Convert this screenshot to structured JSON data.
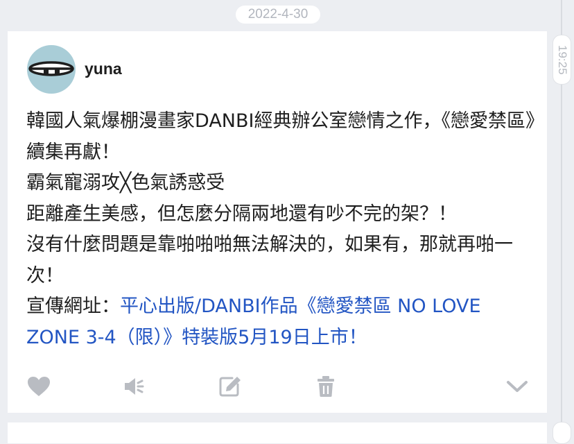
{
  "date_label": "2022-4-30",
  "time_label": "19:25",
  "post": {
    "author": "yuna",
    "lines": [
      "韓國人氣爆棚漫畫家DANBI經典辦公室戀情之作，《戀愛禁區》續集再獻！",
      "霸氣寵溺攻╳色氣誘惑受",
      "距離產生美感，但怎麼分隔兩地還有吵不完的架？！",
      "沒有什麼問題是靠啪啪啪無法解決的，如果有，那就再啪一次！"
    ],
    "link_prefix": "宣傳網址：",
    "link_text": "平心出版/DANBI作品《戀愛禁區 NO LOVE ZONE 3-4（限）》特裝版5月19日上市！"
  },
  "actions": [
    "heart-icon",
    "speaker-icon",
    "edit-icon",
    "trash-icon",
    "chevron-down-icon"
  ],
  "colors": {
    "accent": "#2255c3",
    "icon": "#b9bcc2",
    "avatar_bg": "#a9cdd7",
    "page_bg": "#eceef2"
  }
}
